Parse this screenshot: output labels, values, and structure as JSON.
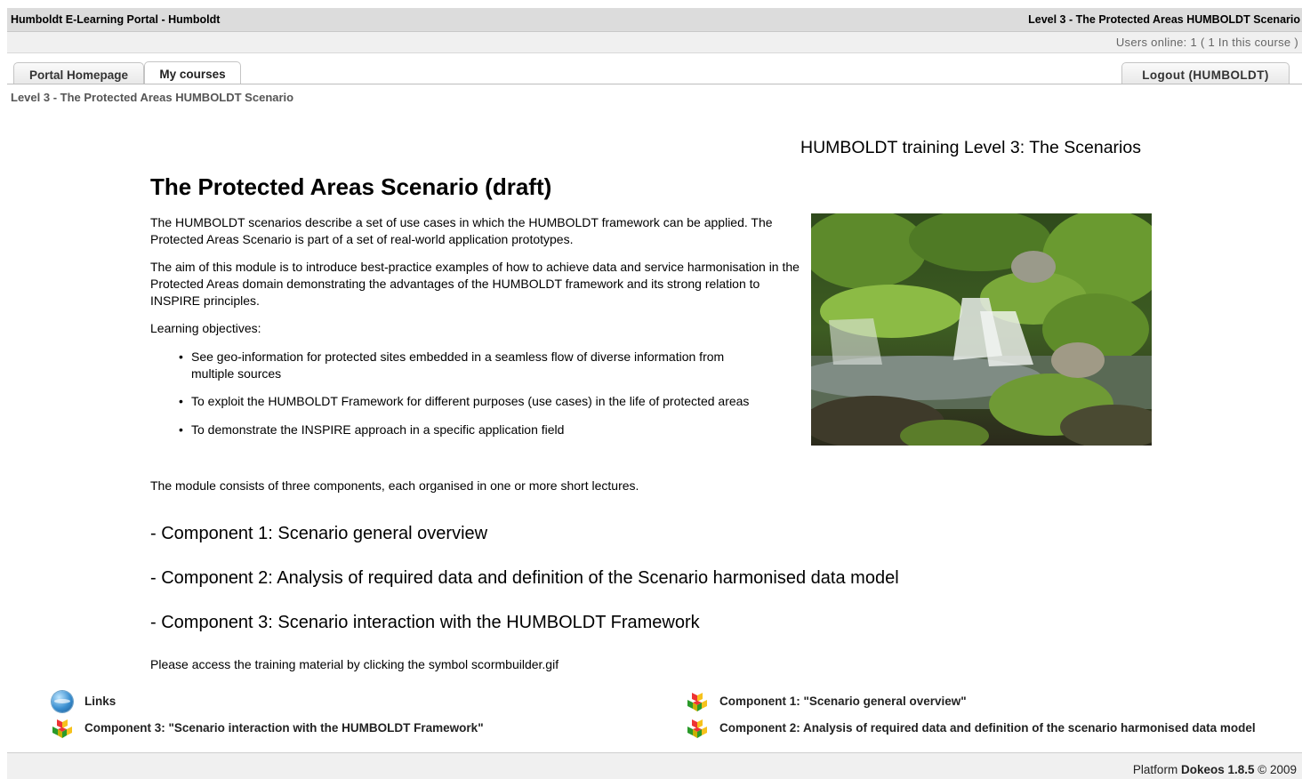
{
  "header": {
    "portal_title": "Humboldt E-Learning Portal - Humboldt",
    "course_title": "Level 3 - The Protected Areas HUMBOLDT Scenario",
    "users_online": "Users online:  1  ( 1 In this course  )"
  },
  "tabs": [
    {
      "label": "Portal Homepage"
    },
    {
      "label": "My courses"
    }
  ],
  "logout_label": "Logout (HUMBOLDT)",
  "breadcrumb": "Level 3 - The Protected Areas HUMBOLDT Scenario",
  "content": {
    "training_title": "HUMBOLDT training Level 3: The Scenarios",
    "main_title": "The Protected Areas Scenario (draft)",
    "intro": "The HUMBOLDT scenarios describe a set of use cases in which the HUMBOLDT framework can be applied. The Protected Areas Scenario is part of a set of real-world application prototypes.",
    "aim": "The aim of this module is to introduce best-practice examples of how to achieve data and service harmonisation in the Protected Areas domain demonstrating the advantages of the HUMBOLDT framework and its strong relation to INSPIRE principles.",
    "objectives_label": "Learning objectives:",
    "objectives": [
      "See geo-information for protected sites embedded in a seamless flow of diverse information from multiple sources",
      "To exploit the HUMBOLDT Framework for different purposes (use cases) in the life of protected areas",
      "To demonstrate the INSPIRE approach in a specific application field"
    ],
    "module_text": "The module consists of three components, each organised in one or more short lectures.",
    "components": [
      "- Component 1: Scenario general overview",
      "- Component 2: Analysis of required data and definition of the Scenario harmonised data model",
      "- Component 3: Scenario interaction with the HUMBOLDT Framework"
    ],
    "access_text": "Please access the training material by clicking the symbol scormbuilder.gif"
  },
  "tools": {
    "links": {
      "label": "Links",
      "icon": "globe-icon"
    },
    "component1": {
      "label": "Component 1: \"Scenario general overview\"",
      "icon": "scorm-cubes-icon"
    },
    "component3": {
      "label": "Component 3: \"Scenario interaction with the HUMBOLDT Framework\"",
      "icon": "scorm-cubes-icon"
    },
    "component2": {
      "label": "Component 2: Analysis of required data and definition of the scenario harmonised data model",
      "icon": "scorm-cubes-icon"
    }
  },
  "footer": {
    "platform_prefix": "Platform",
    "platform_name": "Dokeos 1.8.5",
    "copyright": "© 2009"
  }
}
